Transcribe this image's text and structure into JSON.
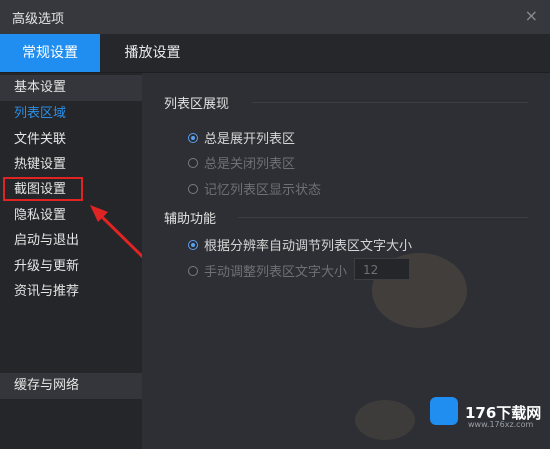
{
  "window": {
    "title": "高级选项",
    "close_glyph": "×"
  },
  "tabs": [
    {
      "label": "常规设置",
      "active": true
    },
    {
      "label": "播放设置",
      "active": false
    }
  ],
  "sidebar": {
    "items": [
      {
        "label": "基本设置"
      },
      {
        "label": "列表区域",
        "active": true
      },
      {
        "label": "文件关联"
      },
      {
        "label": "热键设置"
      },
      {
        "label": "截图设置",
        "highlighted": true
      },
      {
        "label": "隐私设置"
      },
      {
        "label": "启动与退出"
      },
      {
        "label": "升级与更新"
      },
      {
        "label": "资讯与推荐"
      }
    ],
    "bottom_item": "缓存与网络"
  },
  "content": {
    "section1": {
      "title": "列表区展现",
      "options": [
        {
          "label": "总是展开列表区",
          "checked": true,
          "enabled": true
        },
        {
          "label": "总是关闭列表区",
          "checked": false,
          "enabled": false
        },
        {
          "label": "记忆列表区显示状态",
          "checked": false,
          "enabled": false
        }
      ]
    },
    "section2": {
      "title": "辅助功能",
      "options": [
        {
          "label": "根据分辨率自动调节列表区文字大小",
          "checked": true,
          "enabled": true
        },
        {
          "label": "手动调整列表区文字大小",
          "checked": false,
          "enabled": false
        }
      ],
      "font_size_value": "12"
    }
  },
  "watermark": {
    "text": "176下载网",
    "url": "www.176xz.com"
  },
  "colors": {
    "accent": "#1f8ef0",
    "annotation": "#e02424"
  }
}
